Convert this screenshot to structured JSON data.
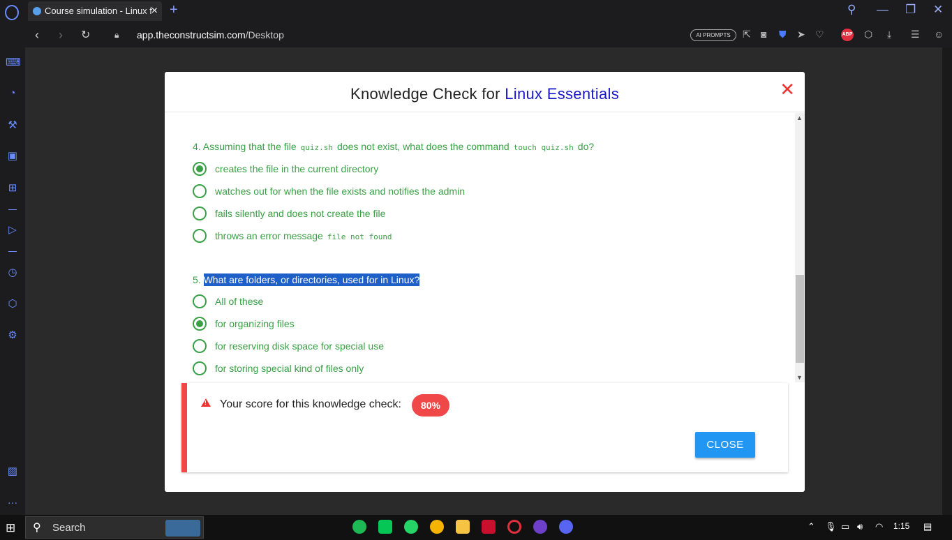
{
  "browser": {
    "tab_title": "Course simulation - Linux f",
    "url_domain": "app.theconstructsim.com",
    "url_path": "/Desktop",
    "ai_prompts_label": "AI PROMPTS",
    "abp_label": "ABP"
  },
  "modal": {
    "title_prefix": "Knowledge Check for ",
    "title_course": "Linux Essentials",
    "close_icon": "✕"
  },
  "question4": {
    "text_a": "4. Assuming that the file",
    "code_a": "quiz.sh",
    "text_b": "does not exist, what does the command",
    "code_b": "touch quiz.sh",
    "text_c": "do?",
    "options": [
      {
        "label": "creates the file in the current directory",
        "code": "",
        "selected": true
      },
      {
        "label": "watches out for when the file exists and notifies the admin",
        "code": "",
        "selected": false
      },
      {
        "label": "fails silently and does not create the file",
        "code": "",
        "selected": false
      },
      {
        "label": "throws an error message",
        "code": "file not found",
        "selected": false
      }
    ]
  },
  "question5": {
    "number": "5. ",
    "text": "What are folders, or directories, used for in Linux?",
    "options": [
      {
        "label": "All of these",
        "selected": false
      },
      {
        "label": "for organizing files",
        "selected": true
      },
      {
        "label": "for reserving disk space for special use",
        "selected": false
      },
      {
        "label": "for storing special kind of files only",
        "selected": false
      }
    ]
  },
  "score": {
    "text": "Your score for this knowledge check:",
    "value": "80%",
    "close_label": "CLOSE"
  },
  "taskbar": {
    "search_label": "Search",
    "time": "1:15"
  },
  "colors": {
    "green": "#3aa045",
    "accent_blue": "#1818c8",
    "danger": "#f04848",
    "button": "#2196f3"
  }
}
